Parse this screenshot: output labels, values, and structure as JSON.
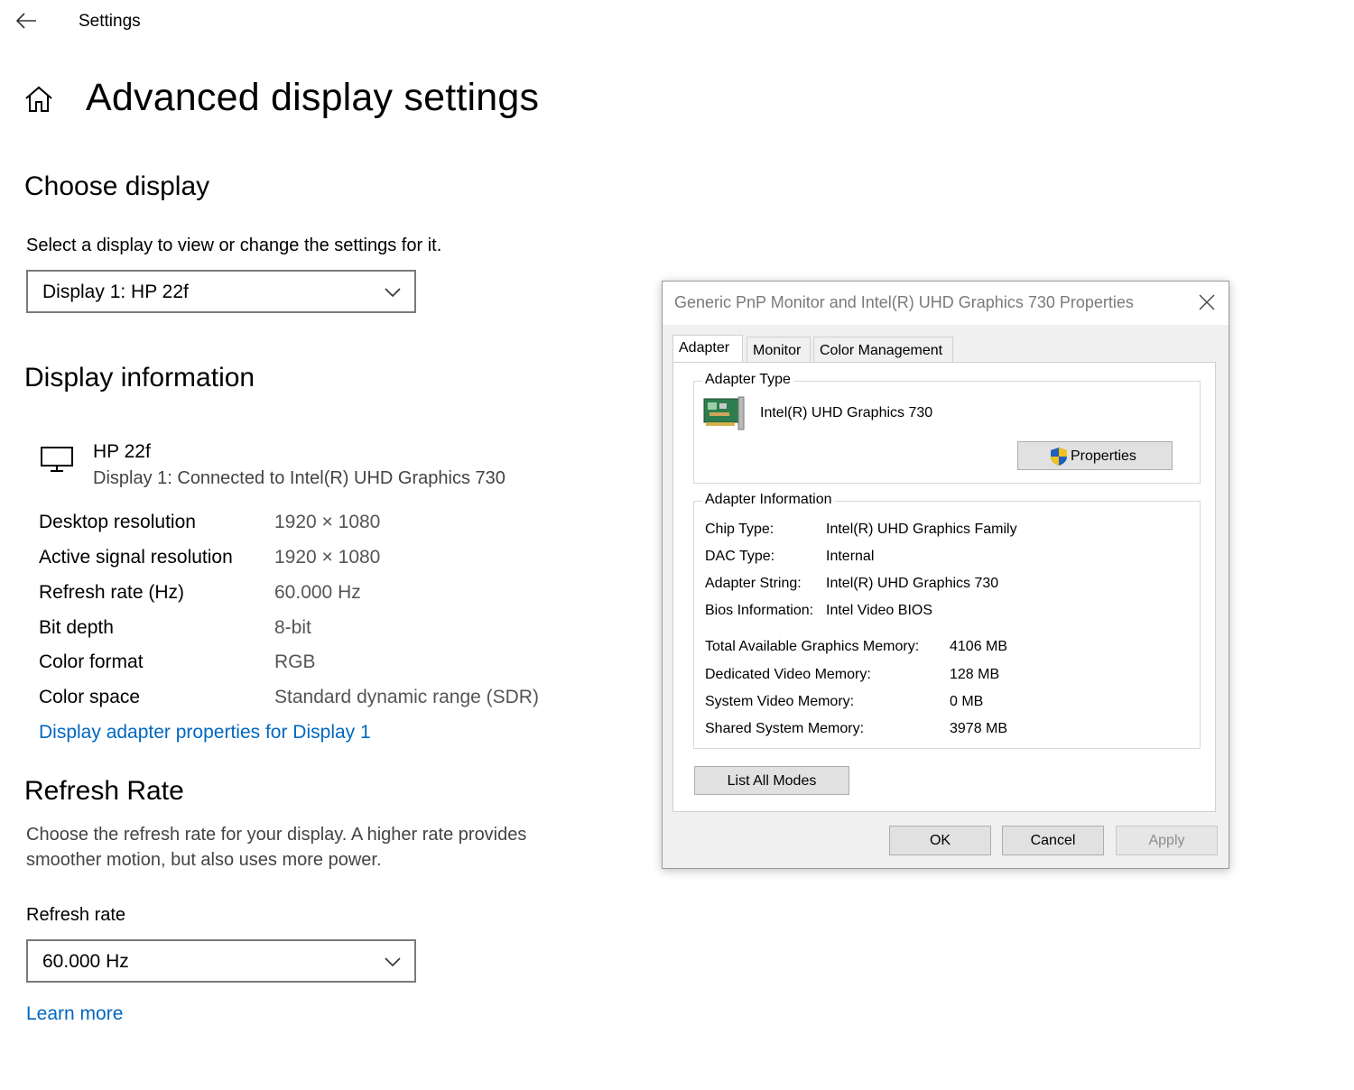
{
  "app": {
    "title": "Settings",
    "page_title": "Advanced display settings"
  },
  "choose_display": {
    "heading": "Choose display",
    "description": "Select a display to view or change the settings for it.",
    "selected_display": "Display 1: HP 22f"
  },
  "display_information": {
    "heading": "Display information",
    "monitor_name": "HP 22f",
    "connection": "Display 1: Connected to Intel(R) UHD Graphics 730",
    "rows": [
      {
        "label": "Desktop resolution",
        "value": "1920 × 1080"
      },
      {
        "label": "Active signal resolution",
        "value": "1920 × 1080"
      },
      {
        "label": "Refresh rate (Hz)",
        "value": "60.000 Hz"
      },
      {
        "label": "Bit depth",
        "value": "8-bit"
      },
      {
        "label": "Color format",
        "value": "RGB"
      },
      {
        "label": "Color space",
        "value": "Standard dynamic range (SDR)"
      }
    ],
    "adapter_link": "Display adapter properties for Display 1"
  },
  "refresh_rate": {
    "heading": "Refresh Rate",
    "description_line1": "Choose the refresh rate for your display. A higher rate provides",
    "description_line2": "smoother motion, but also uses more power.",
    "field_label": "Refresh rate",
    "selected_rate": "60.000 Hz",
    "learn_more": "Learn more"
  },
  "dialog": {
    "title": "Generic PnP Monitor and Intel(R) UHD Graphics 730 Properties",
    "tabs": [
      "Adapter",
      "Monitor",
      "Color Management"
    ],
    "adapter_type": {
      "group_label": "Adapter Type",
      "name": "Intel(R) UHD Graphics 730",
      "properties_button": "Properties"
    },
    "adapter_information": {
      "group_label": "Adapter Information",
      "rows": [
        {
          "label": "Chip Type:",
          "value": "Intel(R) UHD Graphics Family"
        },
        {
          "label": "DAC Type:",
          "value": "Internal"
        },
        {
          "label": "Adapter String:",
          "value": "Intel(R) UHD Graphics 730"
        },
        {
          "label": "Bios Information:",
          "value": "Intel Video BIOS"
        }
      ],
      "memory_rows": [
        {
          "label": "Total Available Graphics Memory:",
          "value": "4106 MB"
        },
        {
          "label": "Dedicated Video Memory:",
          "value": "128 MB"
        },
        {
          "label": "System Video Memory:",
          "value": "0 MB"
        },
        {
          "label": "Shared System Memory:",
          "value": "3978 MB"
        }
      ]
    },
    "list_all_modes_button": "List All Modes",
    "ok_button": "OK",
    "cancel_button": "Cancel",
    "apply_button": "Apply"
  },
  "colors": {
    "link": "#0067c0",
    "shield_blue": "#1f5fbf",
    "shield_yellow": "#f2c21b"
  }
}
